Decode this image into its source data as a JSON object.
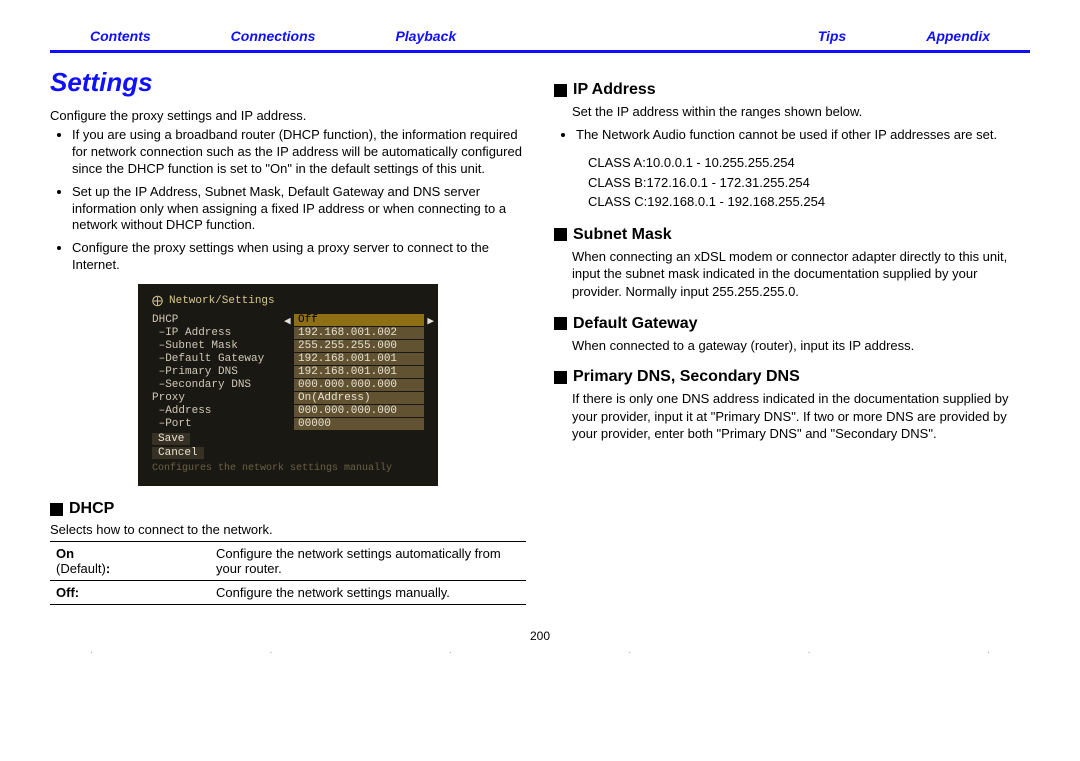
{
  "nav": {
    "contents": "Contents",
    "connections": "Connections",
    "playback": "Playback",
    "tips": "Tips",
    "appendix": "Appendix"
  },
  "left": {
    "title": "Settings",
    "intro": "Configure the proxy settings and IP address.",
    "bullets": [
      "If you are using a broadband router (DHCP function), the information required for network connection such as the IP address will be automatically configured since the DHCP function is set to \"On\" in the default settings of this unit.",
      "Set up the IP Address, Subnet Mask, Default Gateway and DNS server information only when assigning a fixed IP address or when connecting to a network without DHCP function.",
      "Configure the proxy settings when using a proxy server to connect to the Internet."
    ],
    "osd": {
      "title": "Network/Settings",
      "rows": [
        {
          "label": "DHCP",
          "value": "Off",
          "hl": true
        },
        {
          "label": " –IP Address",
          "value": "192.168.001.002"
        },
        {
          "label": " –Subnet Mask",
          "value": "255.255.255.000"
        },
        {
          "label": " –Default Gateway",
          "value": "192.168.001.001"
        },
        {
          "label": " –Primary DNS",
          "value": "192.168.001.001"
        },
        {
          "label": " –Secondary DNS",
          "value": "000.000.000.000"
        },
        {
          "label": "Proxy",
          "value": "On(Address)"
        },
        {
          "label": " –Address",
          "value": "000.000.000.000"
        },
        {
          "label": " –Port",
          "value": "00000"
        }
      ],
      "save": "Save",
      "cancel": "Cancel",
      "hint": "Configures the network settings manually"
    },
    "dhcp": {
      "heading": "DHCP",
      "desc": "Selects how to connect to the network.",
      "rows": [
        {
          "k1": "On",
          "k2": "(Default)",
          "colon1": "",
          "colon2": ":",
          "v": "Configure the network settings automatically from your router."
        },
        {
          "k1": "Off",
          "k2": "",
          "colon1": ":",
          "colon2": "",
          "v": "Configure the network settings manually."
        }
      ]
    }
  },
  "right": {
    "ip": {
      "heading": "IP Address",
      "desc": "Set the IP address within the ranges shown below.",
      "bullet": "The Network Audio function cannot be used if other IP addresses are set.",
      "classes": [
        "CLASS A:10.0.0.1 - 10.255.255.254",
        "CLASS B:172.16.0.1 - 172.31.255.254",
        "CLASS C:192.168.0.1 - 192.168.255.254"
      ]
    },
    "subnet": {
      "heading": "Subnet Mask",
      "desc": "When connecting an xDSL modem or connector adapter directly to this unit, input the subnet mask indicated in the documentation supplied by your provider. Normally input 255.255.255.0."
    },
    "gateway": {
      "heading": "Default Gateway",
      "desc": "When connected to a gateway (router), input its IP address."
    },
    "dns": {
      "heading": "Primary DNS, Secondary DNS",
      "desc": "If there is only one DNS address indicated in the documentation supplied by your provider, input it at \"Primary DNS\". If two or more DNS are provided by your provider, enter both \"Primary DNS\" and \"Secondary DNS\"."
    }
  },
  "pagenum": "200"
}
